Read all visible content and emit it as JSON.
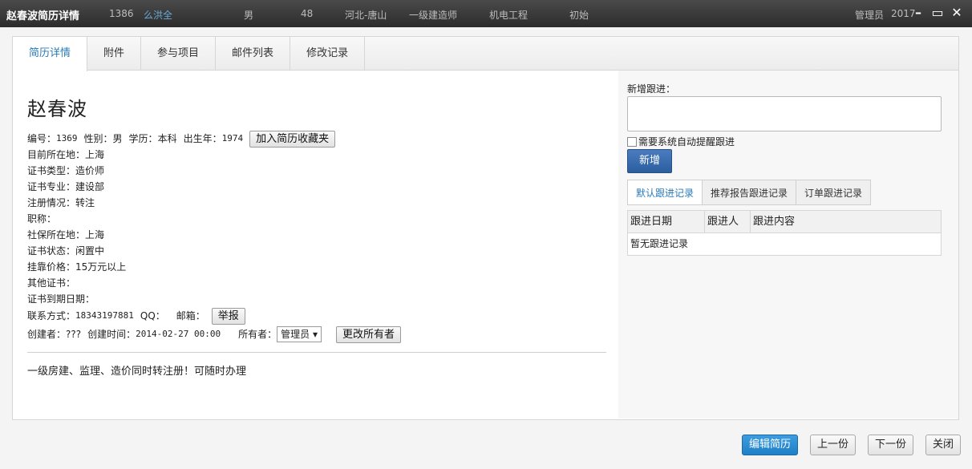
{
  "titlebar": {
    "title": "赵春波简历详情",
    "row": [
      "1386",
      "么洪全",
      "男",
      "48",
      "河北-唐山",
      "一级建造师",
      "机电工程",
      "初始"
    ],
    "user": "管理员",
    "year": "2017",
    "icons": [
      "minimize-icon",
      "maximize-icon",
      "close-icon"
    ]
  },
  "tabs": [
    "简历详情",
    "附件",
    "参与项目",
    "邮件列表",
    "修改记录"
  ],
  "resume": {
    "name": "赵春波",
    "id_label": "编号：",
    "id": "1369",
    "gender_label": "性别：",
    "gender": "男",
    "edu_label": "学历：",
    "edu": "本科",
    "birth_label": "出生年：",
    "birth": "1974",
    "fav_button": "加入简历收藏夹",
    "fields": [
      {
        "label": "目前所在地：",
        "value": "上海"
      },
      {
        "label": "证书类型：",
        "value": "造价师"
      },
      {
        "label": "证书专业：",
        "value": "建设部"
      },
      {
        "label": "注册情况：",
        "value": "转注"
      },
      {
        "label": "职称：",
        "value": ""
      },
      {
        "label": "社保所在地：",
        "value": "上海"
      },
      {
        "label": "证书状态：",
        "value": "闲置中"
      },
      {
        "label": "挂靠价格：",
        "value": "15万元以上"
      },
      {
        "label": "其他证书：",
        "value": ""
      },
      {
        "label": "证书到期日期：",
        "value": ""
      }
    ],
    "contact_label": "联系方式：",
    "contact": "18343197881",
    "qq_label": "QQ：",
    "qq": "",
    "email_label": "邮箱：",
    "email": "",
    "report_button": "举报",
    "creator_label": "创建者：",
    "creator": "???",
    "created_label": "创建时间：",
    "created": "2014-02-27 00:00",
    "owner_label": "所有者：",
    "owner": "管理员",
    "change_owner_button": "更改所有者",
    "remark": "一级房建、监理、造价同时转注册！可随时办理"
  },
  "followup": {
    "new_label": "新增跟进：",
    "remind_label": "需要系统自动提醒跟进",
    "add_button": "新增",
    "subtabs": [
      "默认跟进记录",
      "推荐报告跟进记录",
      "订单跟进记录"
    ],
    "columns": [
      "跟进日期",
      "跟进人",
      "跟进内容"
    ],
    "empty": "暂无跟进记录"
  },
  "footer": {
    "edit": "编辑简历",
    "prev": "上一份",
    "next": "下一份",
    "close": "关闭"
  }
}
